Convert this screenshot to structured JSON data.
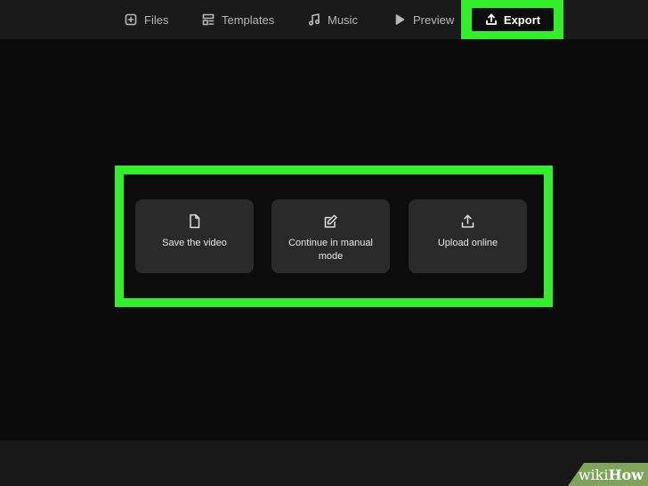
{
  "nav": {
    "files": "Files",
    "templates": "Templates",
    "music": "Music",
    "preview": "Preview",
    "export": "Export"
  },
  "options": {
    "save": "Save the video",
    "manual": "Continue in manual mode",
    "upload": "Upload online"
  },
  "watermark": {
    "wiki": "wiki",
    "how": "How"
  },
  "colors": {
    "highlight": "#33ee2a",
    "background": "#0b0b0b",
    "topbar": "#1a1a1a",
    "card": "#2a2a2a",
    "watermark": "#7fa35a"
  },
  "icons": {
    "files": "add-file-icon",
    "templates": "templates-icon",
    "music": "music-note-icon",
    "preview": "play-icon",
    "export": "export-upload-icon",
    "save": "document-icon",
    "manual": "edit-icon",
    "upload": "upload-icon"
  }
}
